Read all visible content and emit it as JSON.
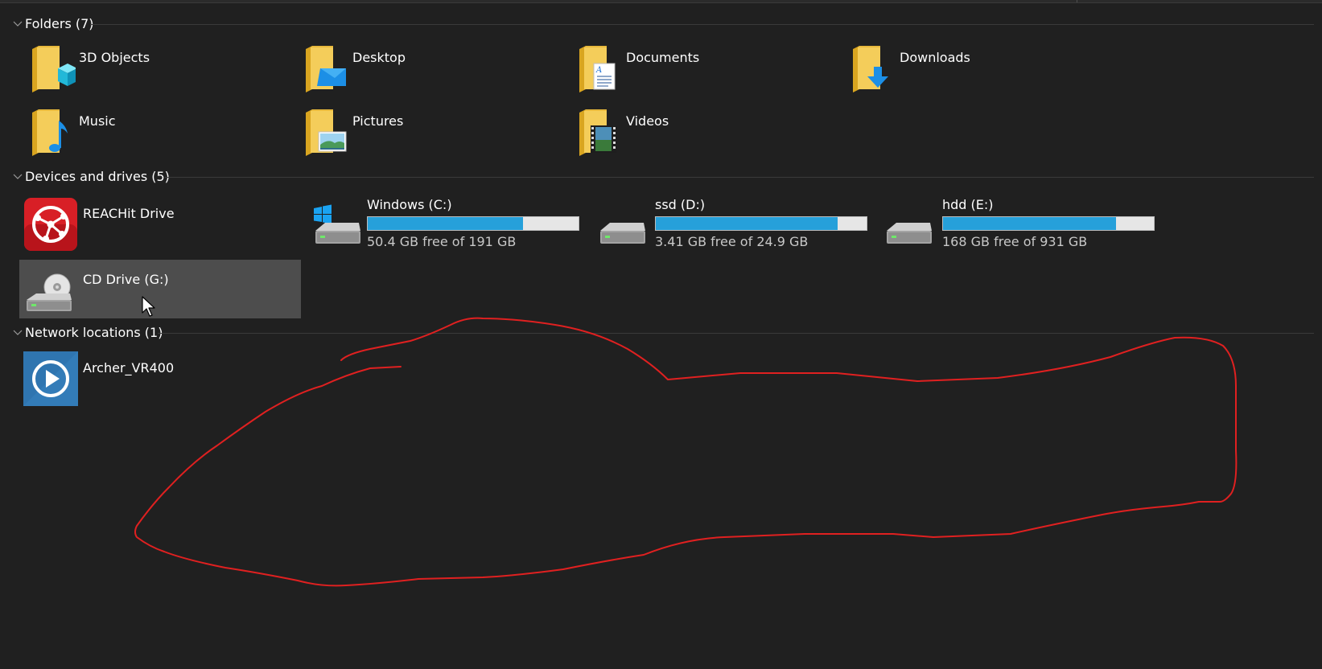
{
  "groups": {
    "folders": {
      "title": "Folders (7)",
      "items": [
        {
          "name": "3D Objects",
          "icon": "folder-3d-objects-icon"
        },
        {
          "name": "Desktop",
          "icon": "folder-desktop-icon"
        },
        {
          "name": "Documents",
          "icon": "folder-documents-icon"
        },
        {
          "name": "Downloads",
          "icon": "folder-downloads-icon"
        },
        {
          "name": "Music",
          "icon": "folder-music-icon"
        },
        {
          "name": "Pictures",
          "icon": "folder-pictures-icon"
        },
        {
          "name": "Videos",
          "icon": "folder-videos-icon"
        }
      ]
    },
    "devices": {
      "title": "Devices and drives (5)",
      "reachit": {
        "name": "REACHit Drive",
        "icon": "reachit-drive-icon"
      },
      "drives": [
        {
          "name": "Windows (C:)",
          "free": "50.4 GB free of 191 GB",
          "used_fraction": 0.736,
          "icon": "windows-drive-icon"
        },
        {
          "name": "ssd  (D:)",
          "free": "3.41 GB free of 24.9 GB",
          "used_fraction": 0.863,
          "icon": "hard-drive-icon"
        },
        {
          "name": "hdd  (E:)",
          "free": "168 GB free of 931 GB",
          "used_fraction": 0.82,
          "icon": "hard-drive-icon"
        }
      ],
      "cd": {
        "name": "CD Drive (G:)",
        "icon": "cd-drive-icon",
        "selected": true
      }
    },
    "network": {
      "title": "Network locations (1)",
      "items": [
        {
          "name": "Archer_VR400",
          "icon": "media-server-icon"
        }
      ]
    }
  },
  "colors": {
    "background": "#202020",
    "selection": "#4d4d4d",
    "bar_fill": "#26a0da",
    "bar_track": "#e6e6e6",
    "annotation": "#e02020"
  }
}
